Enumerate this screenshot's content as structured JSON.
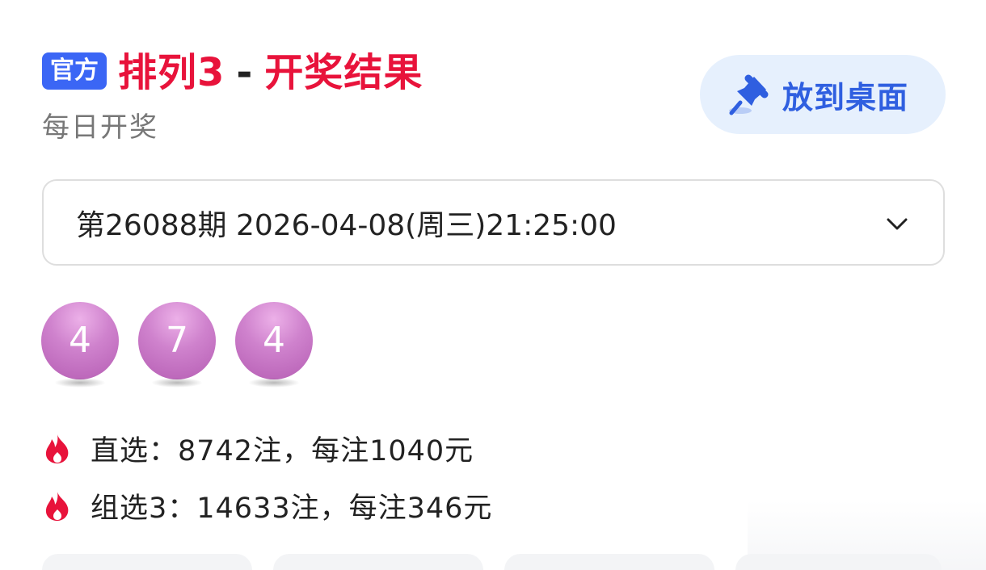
{
  "header": {
    "badge": "官方",
    "title_main": "排列3",
    "title_sep": "-",
    "title_sub": "开奖结果",
    "subtitle": "每日开奖"
  },
  "pin_button": {
    "label": "放到桌面",
    "icon": "pin-icon",
    "color": "#2f5fe0"
  },
  "issue_select": {
    "value": "第26088期 2026-04-08(周三)21:25:00",
    "icon": "chevron-down-icon"
  },
  "balls": [
    "4",
    "7",
    "4"
  ],
  "prizes": [
    {
      "icon": "fire-icon",
      "text": "直选：8742注，每注1040元"
    },
    {
      "icon": "fire-icon",
      "text": "组选3：14633注，每注346元"
    }
  ],
  "colors": {
    "title": "#e8133b",
    "badge": "#3b66f5",
    "ball": "#c976c7",
    "fire": "#e8133b"
  }
}
